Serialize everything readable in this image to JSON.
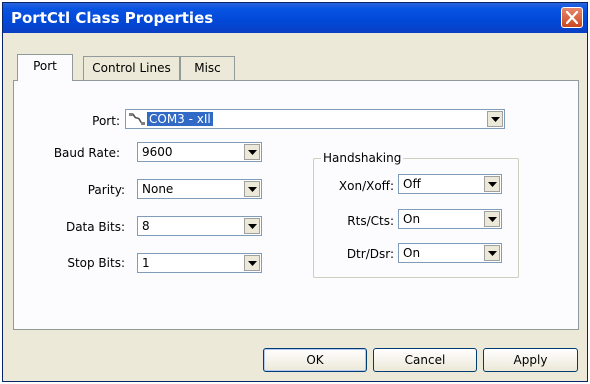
{
  "window": {
    "title": "PortCtl Class Properties"
  },
  "tabs": [
    {
      "label": "Port",
      "active": true
    },
    {
      "label": "Control Lines",
      "active": false
    },
    {
      "label": "Misc",
      "active": false
    }
  ],
  "port": {
    "port_label": "Port:",
    "port_value": "COM3 - xIl",
    "baud_label": "Baud Rate:",
    "baud_value": "9600",
    "parity_label": "Parity:",
    "parity_value": "None",
    "databits_label": "Data Bits:",
    "databits_value": "8",
    "stopbits_label": "Stop Bits:",
    "stopbits_value": "1"
  },
  "handshaking": {
    "legend": "Handshaking",
    "xon_label": "Xon/Xoff:",
    "xon_value": "Off",
    "rts_label": "Rts/Cts:",
    "rts_value": "On",
    "dtr_label": "Dtr/Dsr:",
    "dtr_value": "On"
  },
  "buttons": {
    "ok": "OK",
    "cancel": "Cancel",
    "apply": "Apply"
  },
  "colors": {
    "titlebar": "#0148d8",
    "selection": "#3169c6",
    "face": "#ece9d8"
  },
  "icons": {
    "close": "close-icon",
    "dropdown": "chevron-down-icon",
    "port": "serial-cable-icon"
  }
}
